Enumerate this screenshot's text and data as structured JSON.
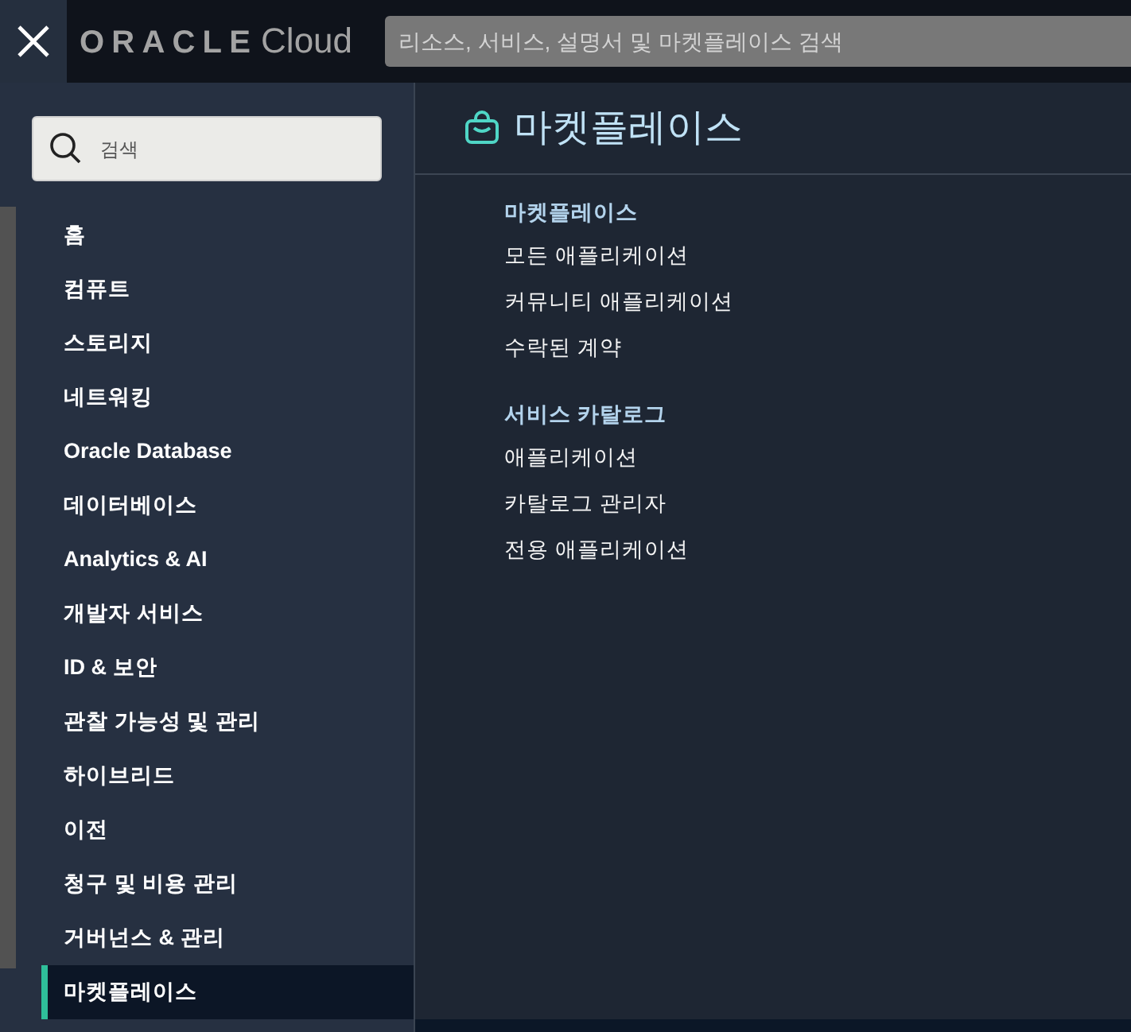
{
  "top_bar": {
    "logo": {
      "brand": "ORACLE",
      "product": "Cloud"
    },
    "search": {
      "placeholder": "리소스, 서비스, 설명서 및 마켓플레이스 검색"
    }
  },
  "sidebar": {
    "search": {
      "placeholder": "검색"
    },
    "items": [
      {
        "label": "홈",
        "selected": false
      },
      {
        "label": "컴퓨트",
        "selected": false
      },
      {
        "label": "스토리지",
        "selected": false
      },
      {
        "label": "네트워킹",
        "selected": false
      },
      {
        "label": "Oracle Database",
        "selected": false
      },
      {
        "label": "데이터베이스",
        "selected": false
      },
      {
        "label": "Analytics & AI",
        "selected": false
      },
      {
        "label": "개발자 서비스",
        "selected": false
      },
      {
        "label": "ID & 보안",
        "selected": false
      },
      {
        "label": "관찰 가능성 및 관리",
        "selected": false
      },
      {
        "label": "하이브리드",
        "selected": false
      },
      {
        "label": "이전",
        "selected": false
      },
      {
        "label": "청구 및 비용 관리",
        "selected": false
      },
      {
        "label": "거버넌스 & 관리",
        "selected": false
      },
      {
        "label": "마켓플레이스",
        "selected": true
      }
    ]
  },
  "panel": {
    "title": "마켓플레이스",
    "sections": [
      {
        "heading": "마켓플레이스",
        "links": [
          "모든 애플리케이션",
          "커뮤니티 애플리케이션",
          "수락된 계약"
        ]
      },
      {
        "heading": "서비스 카탈로그",
        "links": [
          "애플리케이션",
          "카탈로그 관리자",
          "전용 애플리케이션"
        ]
      }
    ]
  }
}
